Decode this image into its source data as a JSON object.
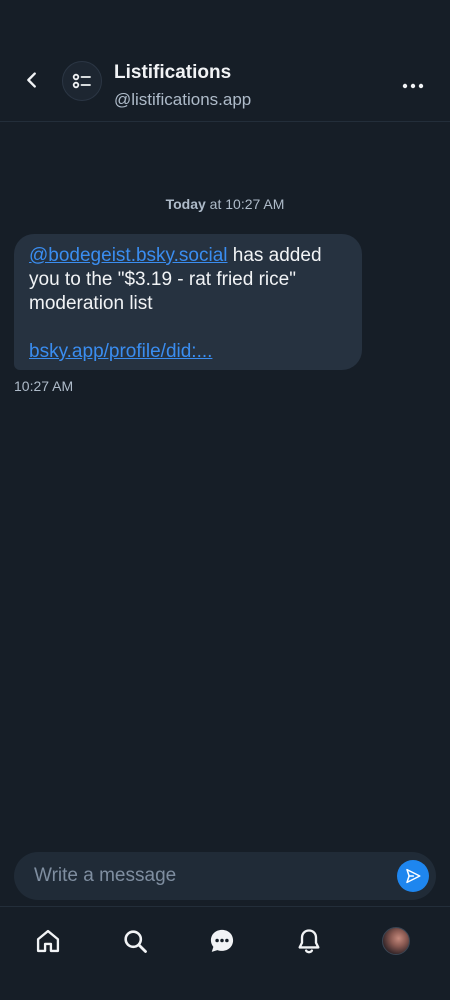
{
  "header": {
    "back_icon": "chevron-left-icon",
    "avatar_icon": "list-icon",
    "name": "Listifications",
    "handle": "@listifications.app",
    "more_icon": "ellipsis-icon"
  },
  "conversation": {
    "date_bold": "Today",
    "date_rest": " at 10:27 AM",
    "message": {
      "mention": "@bodegeist.bsky.social",
      "text": " has added you to the \"$3.19 - rat fried rice\" moderation list",
      "link": "bsky.app/profile/did:...",
      "time": "10:27 AM"
    }
  },
  "composer": {
    "placeholder": "Write a message",
    "send_icon": "send-icon"
  },
  "nav": {
    "items": [
      {
        "icon": "home-icon"
      },
      {
        "icon": "search-icon"
      },
      {
        "icon": "chat-icon"
      },
      {
        "icon": "bell-icon"
      },
      {
        "icon": "profile-avatar"
      }
    ]
  },
  "colors": {
    "background": "#161e27",
    "bubble": "#263240",
    "accent": "#1e86ef",
    "link": "#3a8df0",
    "muted_text": "#aebbc9"
  }
}
